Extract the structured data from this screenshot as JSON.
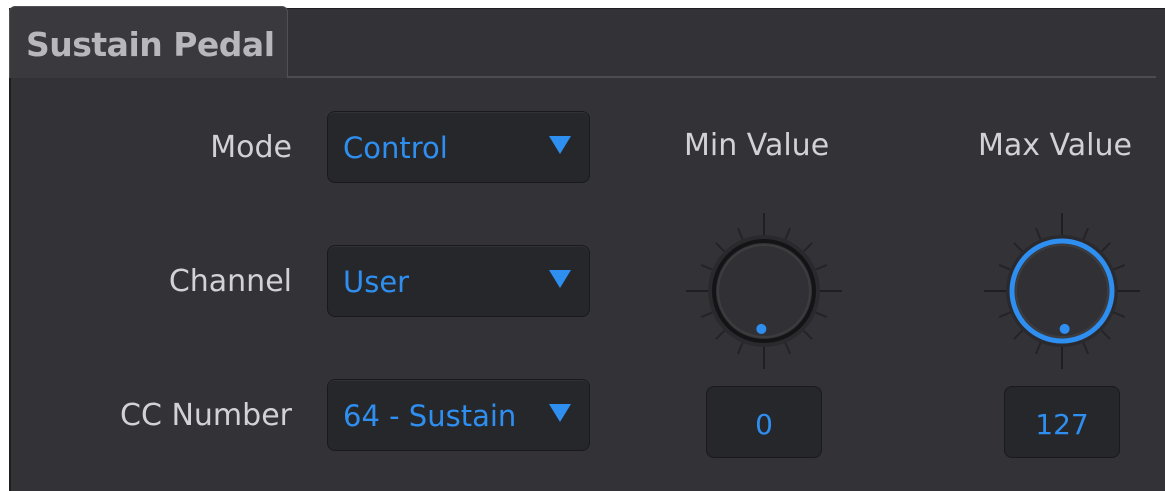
{
  "section": {
    "title": "Sustain Pedal"
  },
  "rows": [
    {
      "label": "Mode",
      "value": "Control"
    },
    {
      "label": "Channel",
      "value": "User"
    },
    {
      "label": "CC Number",
      "value": "64 - Sustain"
    }
  ],
  "knobs": [
    {
      "label": "Min Value",
      "value": "0",
      "level": 0.0,
      "active": false
    },
    {
      "label": "Max Value",
      "value": "127",
      "level": 1.0,
      "active": true
    }
  ],
  "colors": {
    "accent": "#2e8ff0",
    "panel": "#333337",
    "label": "#d2d2d6"
  }
}
